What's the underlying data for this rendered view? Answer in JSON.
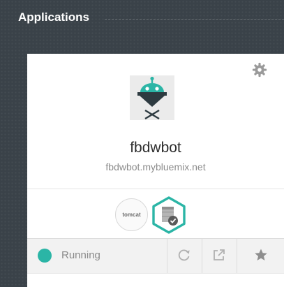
{
  "section": {
    "title": "Applications"
  },
  "app": {
    "name": "fbdwbot",
    "route": "fbdwbot.mybluemix.net",
    "icon": "robot-app-icon"
  },
  "services": [
    {
      "label": "tomcat",
      "icon": "tomcat-runtime-icon"
    },
    {
      "label": "",
      "icon": "database-service-icon"
    }
  ],
  "status": {
    "label": "Running",
    "color": "#2bb5a6"
  },
  "actions": [
    {
      "icon": "restart-icon"
    },
    {
      "icon": "open-external-icon"
    },
    {
      "icon": "star-icon"
    }
  ],
  "colors": {
    "accent": "#2bb5a6",
    "background": "#3a4249",
    "card": "#ffffff"
  }
}
